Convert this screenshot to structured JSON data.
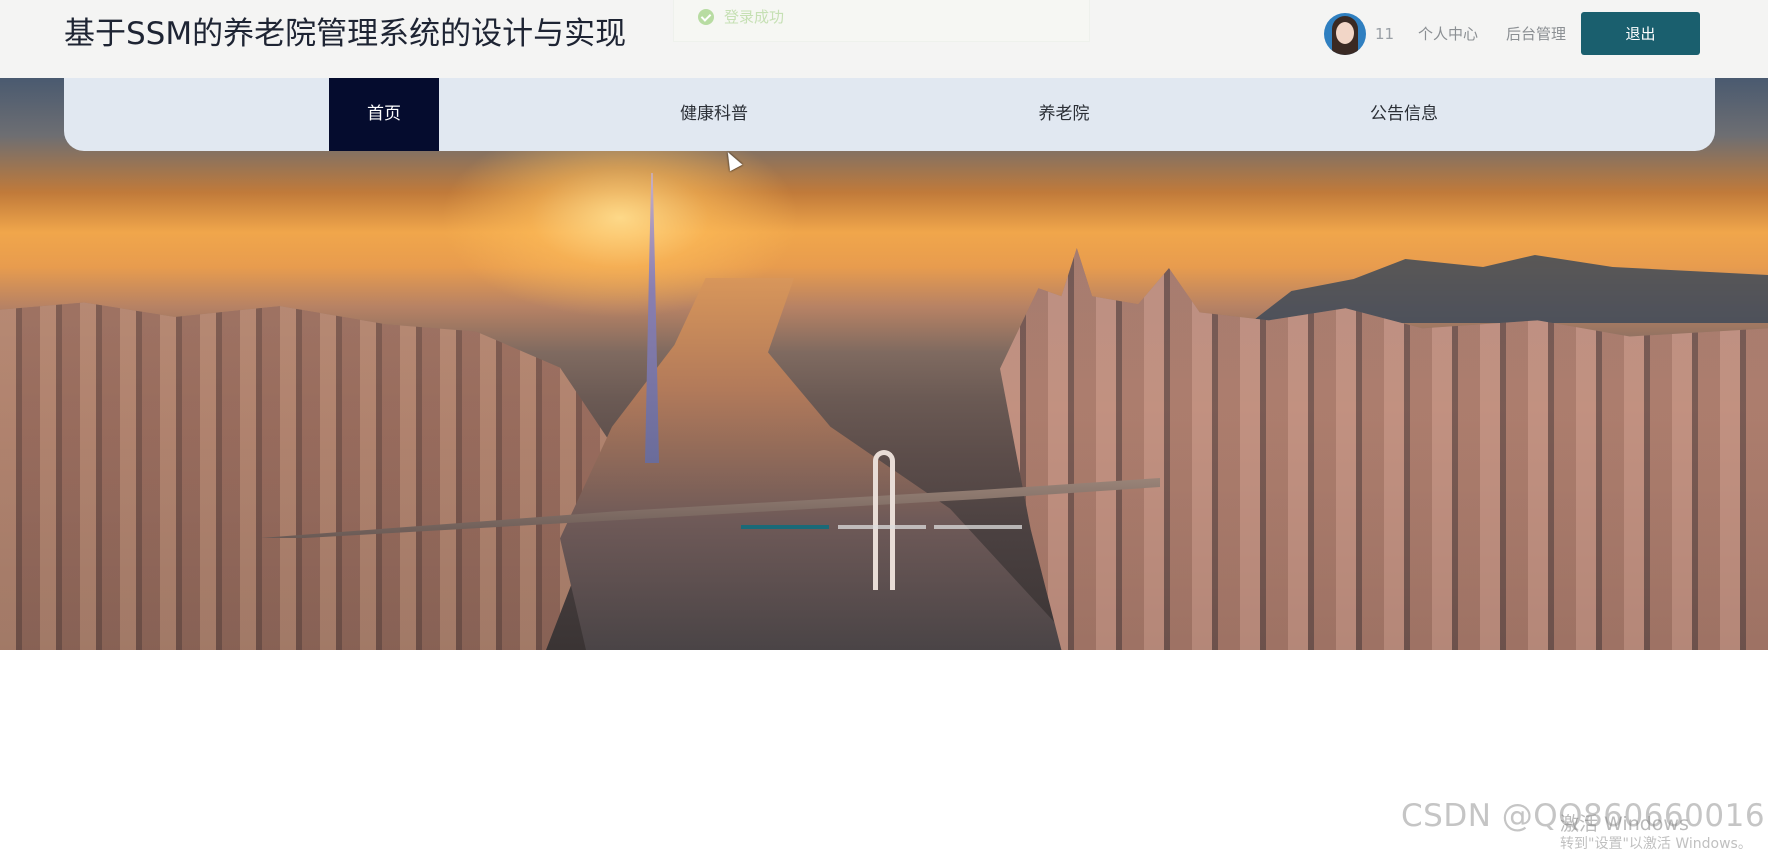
{
  "header": {
    "site_title": "基于SSM的养老院管理系统的设计与实现",
    "toast": {
      "message": "登录成功",
      "icon": "check-circle-icon",
      "color": "#c6e0b4"
    },
    "user": {
      "avatar_icon": "user-avatar",
      "username": "11"
    },
    "links": {
      "profile": "个人中心",
      "admin": "后台管理"
    },
    "logout_label": "退出"
  },
  "nav": {
    "items": [
      {
        "label": "首页",
        "active": true
      },
      {
        "label": "健康科普",
        "active": false
      },
      {
        "label": "养老院",
        "active": false
      },
      {
        "label": "公告信息",
        "active": false
      }
    ]
  },
  "carousel": {
    "slide_count": 3,
    "active_index": 0
  },
  "colors": {
    "accent": "#1a5f6e",
    "nav_active_bg": "#050c2e",
    "nav_bg": "#e1e8f1",
    "header_bg": "#f4f4f3"
  },
  "watermarks": {
    "csdn": "CSDN @QQ860660016",
    "windows_line1": "激活 Windows",
    "windows_line2": "转到\"设置\"以激活 Windows。"
  }
}
